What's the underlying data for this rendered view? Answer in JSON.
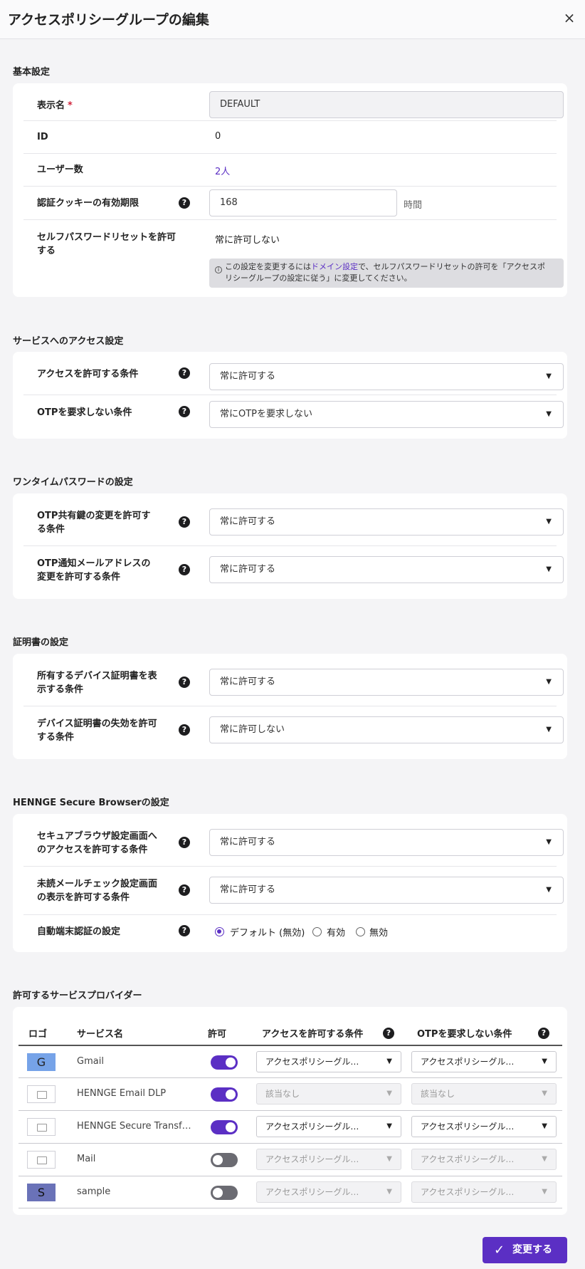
{
  "header": {
    "title": "アクセスポリシーグループの編集",
    "close": "×"
  },
  "basic": {
    "section": "基本設定",
    "display_name_label": "表示名",
    "required_mark": "*",
    "display_name_value": "DEFAULT",
    "id_label": "ID",
    "id_value": "0",
    "users_label": "ユーザー数",
    "users_value": "2人",
    "cookie_label": "認証クッキーの有効期限",
    "cookie_value": "168",
    "cookie_unit": "時間",
    "reset_label_1": "セルフパスワードリセットを許可",
    "reset_label_2": "する",
    "reset_value": "常に許可しない",
    "notice_1a": "この設定を変更するには",
    "notice_link": "ドメイン設定",
    "notice_1b": "で、セルフパスワードリセットの許可を「アクセスポ",
    "notice_2": "リシーグループの設定に従う」に変更してください。"
  },
  "service_access": {
    "section": "サービスへのアクセス設定",
    "access_label": "アクセスを許可する条件",
    "access_value": "常に許可する",
    "otp_label": "OTPを要求しない条件",
    "otp_value": "常にOTPを要求しない"
  },
  "otp": {
    "section": "ワンタイムパスワードの設定",
    "key_label_1": "OTP共有鍵の変更を許可す",
    "key_label_2": "る条件",
    "key_value": "常に許可する",
    "mail_label_1": "OTP通知メールアドレスの",
    "mail_label_2": "変更を許可する条件",
    "mail_value": "常に許可する"
  },
  "cert": {
    "section": "証明書の設定",
    "show_label_1": "所有するデバイス証明書を表",
    "show_label_2": "示する条件",
    "show_value": "常に許可する",
    "revoke_label_1": "デバイス証明書の失効を許可",
    "revoke_label_2": "する条件",
    "revoke_value": "常に許可しない"
  },
  "browser": {
    "section": "HENNGE Secure Browserの設定",
    "settings_label_1": "セキュアブラウザ設定画面へ",
    "settings_label_2": "のアクセスを許可する条件",
    "settings_value": "常に許可する",
    "unread_label_1": "未読メールチェック設定画面",
    "unread_label_2": "の表示を許可する条件",
    "unread_value": "常に許可する",
    "auto_label": "自動端末認証の設定",
    "options": [
      "デフォルト (無効)",
      "有効",
      "無効"
    ],
    "selected": "デフォルト (無効)"
  },
  "providers": {
    "section": "許可するサービスプロバイダー",
    "columns": [
      "ロゴ",
      "サービス名",
      "許可",
      "アクセスを許可する条件",
      "OTPを要求しない条件"
    ],
    "rows": [
      {
        "logo": "G",
        "name": "Gmail",
        "allowed": true,
        "access": "アクセスポリシーグル…",
        "otp": "アクセスポリシーグル…"
      },
      {
        "logo": "",
        "name": "HENNGE Email DLP",
        "allowed": true,
        "access": "該当なし",
        "otp": "該当なし"
      },
      {
        "logo": "",
        "name": "HENNGE Secure Transf…",
        "allowed": true,
        "access": "アクセスポリシーグル…",
        "otp": "アクセスポリシーグル…"
      },
      {
        "logo": "",
        "name": "Mail",
        "allowed": false,
        "access": "アクセスポリシーグル…",
        "otp": "アクセスポリシーグル…"
      },
      {
        "logo": "S",
        "name": "sample",
        "allowed": false,
        "access": "アクセスポリシーグル…",
        "otp": "アクセスポリシーグル…"
      }
    ]
  },
  "footer": {
    "save_label": "変更する"
  },
  "colors": {
    "accent": "#5b2fc4",
    "required": "#d0243b"
  }
}
